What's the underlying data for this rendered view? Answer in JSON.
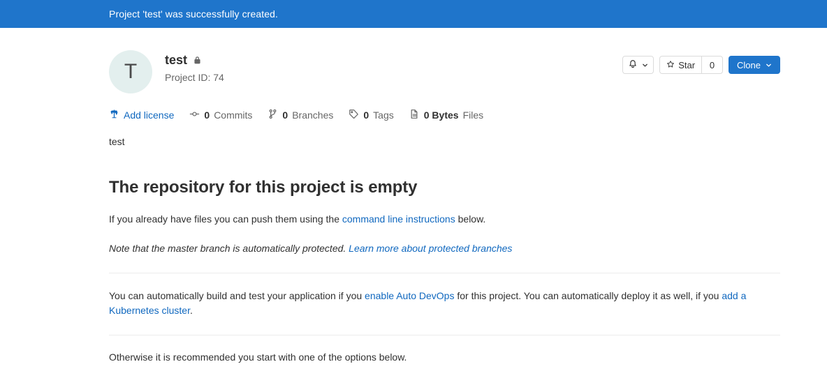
{
  "flash": {
    "message": "Project 'test' was successfully created.",
    "background": "#1f75cb",
    "text_color": "#ffffff"
  },
  "project": {
    "avatar_initial": "T",
    "avatar_background": "#e3efee",
    "name": "test",
    "visibility_icon": "lock-icon",
    "visibility": "Private",
    "project_id_label": "Project ID: 74",
    "description": "test"
  },
  "header_actions": {
    "notification": {
      "icon": "bell-icon",
      "dropdown_icon": "chevron-down-icon"
    },
    "star": {
      "icon": "star-icon",
      "label": "Star",
      "count": "0"
    },
    "clone": {
      "label": "Clone",
      "dropdown_icon": "chevron-down-icon",
      "background": "#1f75cb"
    }
  },
  "stats": [
    {
      "icon": "scale-icon",
      "num": "",
      "label": "Add license",
      "is_link": true
    },
    {
      "icon": "commit-icon",
      "num": "0",
      "label": "Commits",
      "is_link": false
    },
    {
      "icon": "branch-icon",
      "num": "0",
      "label": "Branches",
      "is_link": false
    },
    {
      "icon": "tag-icon",
      "num": "0",
      "label": "Tags",
      "is_link": false
    },
    {
      "icon": "document-icon",
      "num": "0 Bytes",
      "label": "Files",
      "is_link": false
    }
  ],
  "empty_state": {
    "title": "The repository for this project is empty",
    "push_text_before": "If you already have files you can push them using the ",
    "push_link": "command line instructions",
    "push_text_after": " below.",
    "protected_note": "Note that the master branch is automatically protected. ",
    "protected_link": "Learn more about protected branches",
    "autodevops_before": "You can automatically build and test your application if you ",
    "autodevops_link": "enable Auto DevOps",
    "autodevops_middle": " for this project. You can automatically deploy it as well, if you ",
    "kubernetes_link": "add a Kubernetes cluster",
    "autodevops_after": ".",
    "otherwise_text": "Otherwise it is recommended you start with one of the options below."
  },
  "colors": {
    "accent": "#1f75cb",
    "link": "#1068bf",
    "text": "#303030",
    "muted": "#666666",
    "divider": "#ececec"
  }
}
